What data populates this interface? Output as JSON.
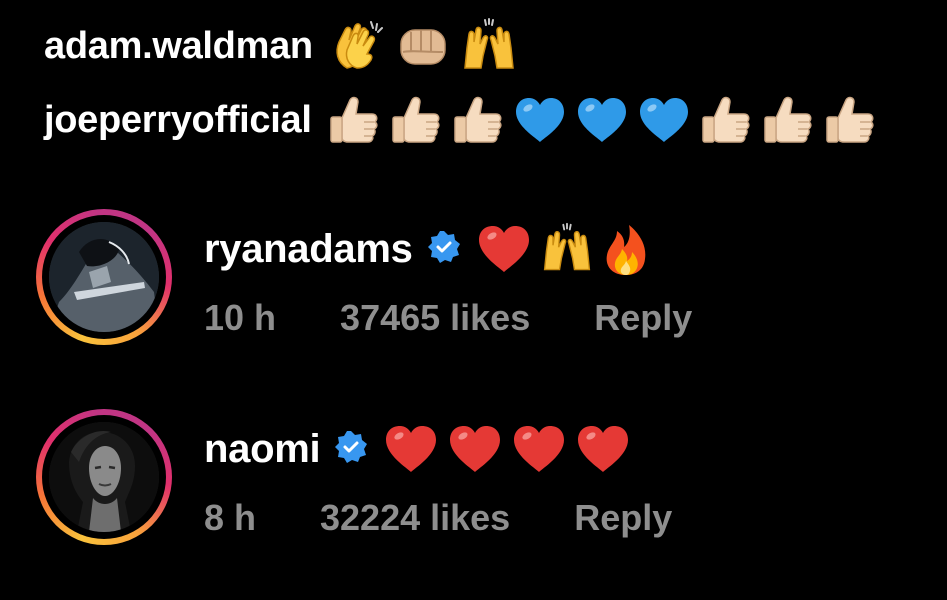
{
  "reply_lines": [
    {
      "username": "adam.waldman",
      "emojis": [
        "clapping-hands",
        "fist-bump",
        "raising-hands"
      ]
    },
    {
      "username": "joeperryofficial",
      "emojis": [
        "thumbs-up",
        "thumbs-up",
        "thumbs-up",
        "blue-heart",
        "blue-heart",
        "blue-heart",
        "thumbs-up",
        "thumbs-up",
        "thumbs-up"
      ]
    }
  ],
  "comments": [
    {
      "username": "ryanadams",
      "verified": true,
      "emojis": [
        "red-heart",
        "raising-hands",
        "fire"
      ],
      "time": "10 h",
      "likes": "37465 likes",
      "reply_label": "Reply"
    },
    {
      "username": "naomi",
      "verified": true,
      "emojis": [
        "red-heart",
        "red-heart",
        "red-heart",
        "red-heart"
      ],
      "time": "8 h",
      "likes": "32224 likes",
      "reply_label": "Reply"
    }
  ],
  "colors": {
    "background": "#000000",
    "text_primary": "#ffffff",
    "text_secondary": "#8e8e8e",
    "verified_blue": "#3897f0"
  }
}
